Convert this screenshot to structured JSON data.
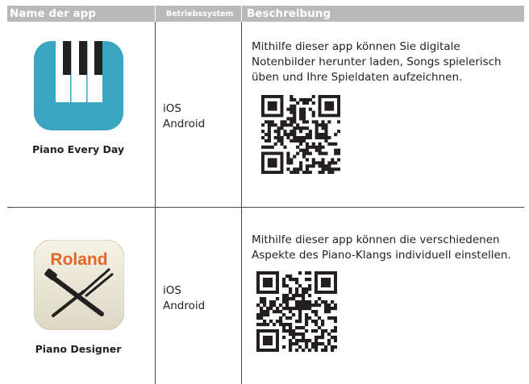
{
  "table": {
    "headers": {
      "app_name": "Name der app",
      "os": "Betriebssystem",
      "description": "Beschreibung"
    },
    "rows": [
      {
        "app_name": "Piano Every Day",
        "os": [
          "iOS",
          "Android"
        ],
        "description": "Mithilfe dieser app können Sie digitale Notenbilder herunter laden, Songs spielerisch üben und Ihre Spieldaten aufzeichnen.",
        "icon": "piano-keys-icon",
        "icon_color": "#3aa5c1"
      },
      {
        "app_name": "Piano Designer",
        "os": [
          "iOS",
          "Android"
        ],
        "description": "Mithilfe dieser app können die verschiedenen Aspekte des Piano-Klangs individuell einstellen.",
        "icon": "roland-tuning-tools-icon",
        "icon_brand": "Roland",
        "icon_brand_color": "#e2662a"
      }
    ]
  },
  "colors": {
    "header_bg": "#b9b9ba",
    "header_text": "#ffffff",
    "rule": "#4a4a4a"
  }
}
